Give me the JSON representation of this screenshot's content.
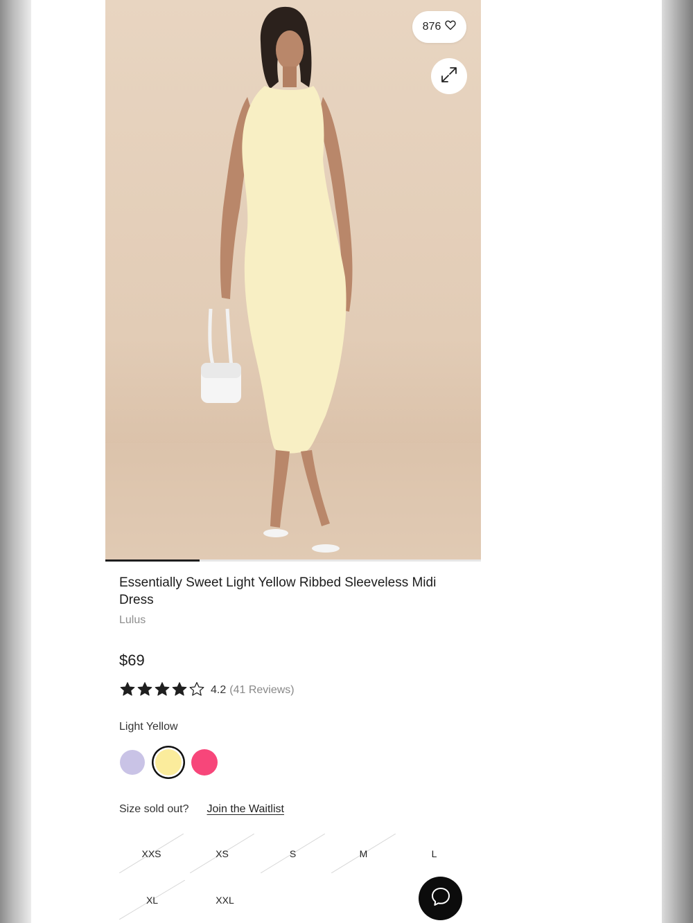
{
  "product": {
    "like_count": "876",
    "title": "Essentially Sweet Light Yellow Ribbed Sleeveless Midi Dress",
    "brand": "Lulus",
    "price": "$69",
    "rating": {
      "value": "4.2",
      "stars": 4.2,
      "reviews_label": "(41 Reviews)"
    },
    "image_progress": 0.25
  },
  "color": {
    "selected_name": "Light Yellow",
    "swatches": [
      {
        "name": "lavender",
        "hex": "#c9c3e6"
      },
      {
        "name": "light-yellow",
        "hex": "#fbec9c",
        "selected": true
      },
      {
        "name": "pink",
        "hex": "#f7467a"
      }
    ]
  },
  "sizes": {
    "soldout_question": "Size sold out?",
    "waitlist_link": "Join the Waitlist",
    "options": [
      {
        "label": "XXS",
        "sold_out": true
      },
      {
        "label": "XS",
        "sold_out": true
      },
      {
        "label": "S",
        "sold_out": true
      },
      {
        "label": "M",
        "sold_out": true
      },
      {
        "label": "L",
        "sold_out": false
      },
      {
        "label": "XL",
        "sold_out": true
      },
      {
        "label": "XXL",
        "sold_out": false
      }
    ]
  },
  "icons": {
    "like": "heart-icon",
    "expand": "expand-icon",
    "chat": "chat-bubble-icon",
    "star": "star-icon"
  },
  "colors": {
    "accent_dark": "#111111",
    "star_fill": "#1f1f1f",
    "muted_text": "#8e8e8e"
  }
}
